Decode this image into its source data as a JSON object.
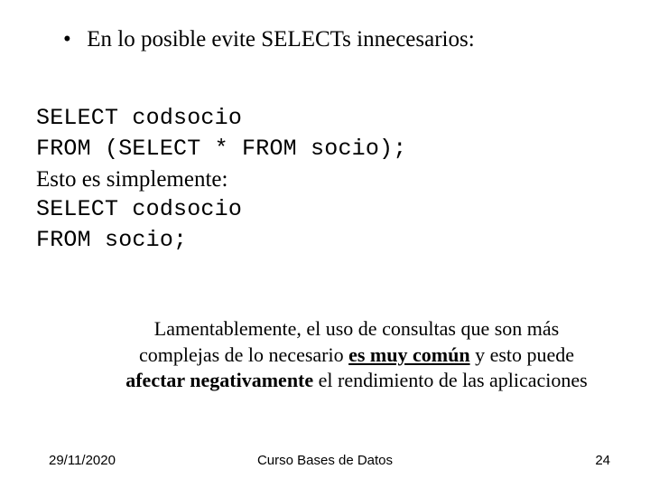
{
  "bullet": {
    "text": "En lo posible evite SELECTs innecesarios:"
  },
  "code": {
    "line1": "SELECT codsocio",
    "line2": "FROM (SELECT * FROM socio);",
    "note": "Esto es simplemente:",
    "line3": "SELECT codsocio",
    "line4": "FROM socio;"
  },
  "comment": {
    "w1": "Lamentablemente, el uso de consultas que son más",
    "w2a": "complejas de lo necesario ",
    "w2b": "es muy común",
    "w2c": " y esto puede",
    "w3a": "afectar negativamente",
    "w3b": " el rendimiento de las aplicaciones"
  },
  "footer": {
    "date": "29/11/2020",
    "title": "Curso Bases de Datos",
    "page": "24"
  }
}
